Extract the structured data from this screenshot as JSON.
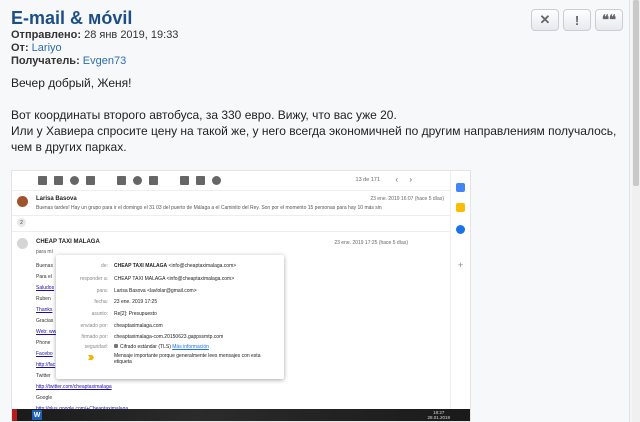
{
  "post": {
    "title": "E-mail & мóvil",
    "sent_label": "Отправлено:",
    "sent_value": "28 янв 2019, 19:33",
    "from_label": "От:",
    "from_value": "Lariyo",
    "to_label": "Получатель:",
    "to_value": "Evgen73",
    "actions": [
      "✕",
      "!",
      "❝❝"
    ],
    "body": {
      "line1": "Вечер добрый, Женя!",
      "line2": "Вот координаты второго автобуса, за 330 евро. Вижу, что вас уже 20.",
      "line3": "Или у Хавиера спросите цену на такой же, у него всегда экономичней по другим направлениям получалось,",
      "line4": "чем в других парках."
    }
  },
  "gmail": {
    "count": "13 de 171",
    "nav_prev": "‹",
    "nav_next": "›",
    "msg1": {
      "sender": "Larisa Basova",
      "snippet": "Buenas tardes! Hay un grupo para ir el domingo el 31 03 del puerto de Málaga a el Caminito del Rey. Son por el momento 15 personas para hay 10 más sin",
      "date": "23 ene. 2019 16:07 (hace 5 días)"
    },
    "collapsed_count": "2",
    "msg2": {
      "sender": "CHEAP TAXI MALAGA",
      "to_line": "para mí",
      "date": "23 ene. 2019 17:25 (hace 5 días)"
    },
    "left_lines": [
      "Buenas",
      "Para el",
      "Saludos",
      "Ruben",
      "Thanks",
      "Gracias",
      "Web: ww",
      "Phone",
      "Facebo",
      "http://fac",
      "Twitter",
      "http://twitter.com/cheaptaximalaga",
      "Google",
      "http://plus.google.com/+Cheaptaximalaga"
    ],
    "popup": {
      "rows": [
        {
          "k": "de:",
          "v": "CHEAP TAXI MALAGA",
          "v2": "<info@cheaptaximalaga.com>"
        },
        {
          "k": "responder a:",
          "v": "",
          "v2": "CHEAP TAXI MALAGA <info@cheaptaximalaga.com>"
        },
        {
          "k": "para:",
          "v": "",
          "v2": "Larisa Basova <lavlolar@gmail.com>"
        },
        {
          "k": "fecha:",
          "v": "",
          "v2": "23 ene. 2019 17:25"
        },
        {
          "k": "asunto:",
          "v": "",
          "v2": "Re[2]: Presupuesto"
        },
        {
          "k": "enviado por:",
          "v": "",
          "v2": "cheaptaximalaga.com"
        },
        {
          "k": "firmado por:",
          "v": "",
          "v2": "cheaptaximalaga-com.20150623.gappssmtp.com"
        },
        {
          "k": "seguridad:",
          "v": "",
          "v2": "Cifrado estándar (TLS)"
        }
      ],
      "security_more": "Más información",
      "note": "Mensaje importante porque generalmente lees mensajes con esta etiqueta"
    },
    "taskbar": {
      "time": "18:27",
      "date": "28.01.2019"
    }
  }
}
